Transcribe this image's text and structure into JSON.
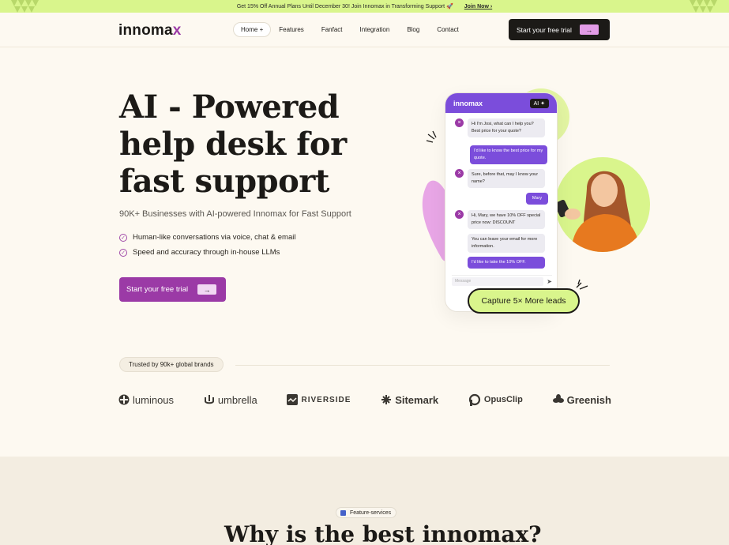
{
  "announcement": {
    "text": "Get 15% Off Annual Plans Until December 30! Join Innomax in Transforming Support 🚀",
    "link": "Join Now ›"
  },
  "nav": {
    "logo": "innoma",
    "logo_accent": "x",
    "items": [
      "Home +",
      "Features",
      "Fanfact",
      "Integration",
      "Blog",
      "Contact"
    ],
    "cta": "Start your free trial"
  },
  "hero": {
    "title_lines": [
      "AI - Powered",
      "help desk for",
      "fast support"
    ],
    "subtitle": "90K+ Businesses with AI-powered Innomax for Fast Support",
    "features": [
      "Human-like conversations via voice, chat & email",
      "Speed and accuracy through in-house LLMs"
    ],
    "cta": "Start your free trial"
  },
  "chat": {
    "brand": "innomax",
    "ai_badge": "AI ✦",
    "messages": [
      {
        "from": "bot",
        "text": "Hi I'm Josi, what can I help you? Best price for your quote?"
      },
      {
        "from": "user",
        "text": "I'd like to know the best price for my quote."
      },
      {
        "from": "bot",
        "text": "Sure, before that, may I know your name?"
      },
      {
        "from": "user",
        "text": "Mary"
      },
      {
        "from": "bot",
        "text": "Hi, Mary, we have 10% OFF special price now: DISCOUNT"
      },
      {
        "from": "bot",
        "text": "You can leave your email for more information."
      },
      {
        "from": "user",
        "text": "I'd like to take the 10% OFF."
      }
    ],
    "composer_placeholder": "Message",
    "capture_label": "Capture 5× More leads"
  },
  "trusted": {
    "label": "Trusted by 90k+ global brands",
    "brands": [
      "luminous",
      "umbrella",
      "RIVERSIDE",
      "Sitemark",
      "OpusClip",
      "Greenish"
    ]
  },
  "section2": {
    "badge": "Feature-services",
    "heading": "Why is the best innomax?"
  },
  "colors": {
    "accent": "#9b3aa6",
    "lime": "#d9f58c",
    "chat_purple": "#7b4ddb",
    "background": "#fdf9f1"
  }
}
